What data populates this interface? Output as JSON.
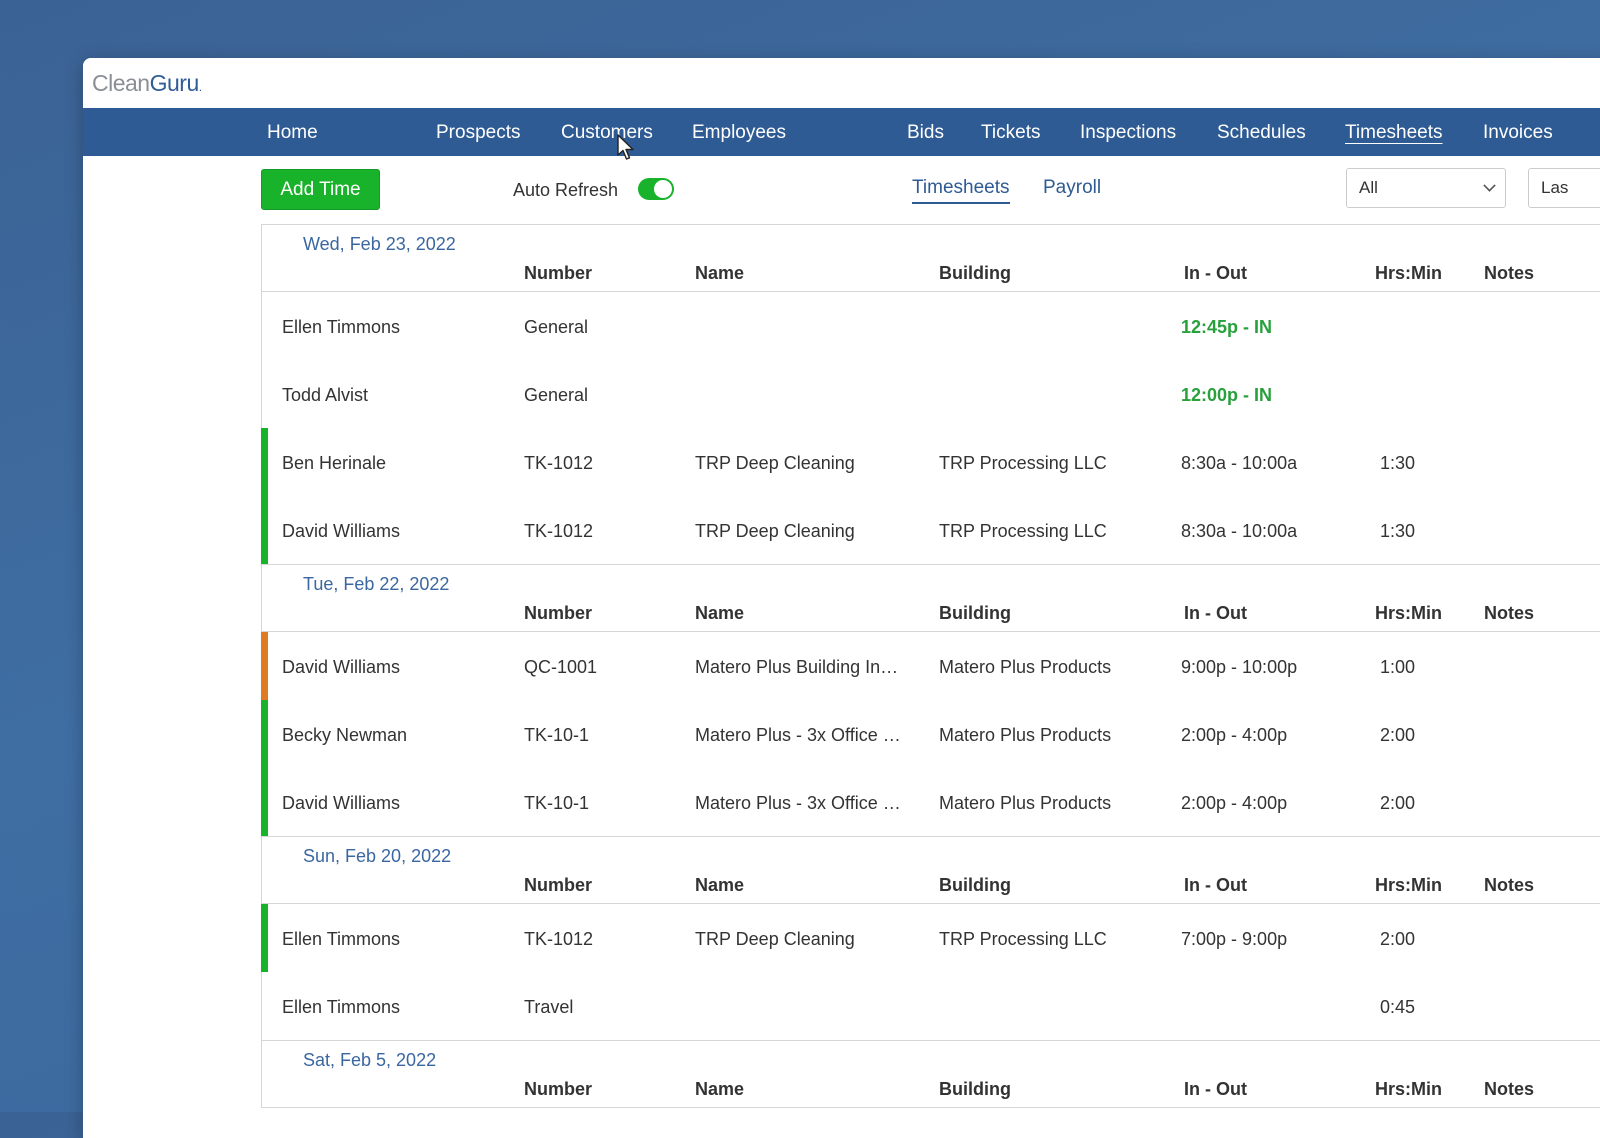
{
  "app": {
    "logo": {
      "part1": "Clean",
      "part2": "Guru",
      "dot": "."
    }
  },
  "nav": [
    {
      "label": "Home"
    },
    {
      "label": "Prospects"
    },
    {
      "label": "Customers"
    },
    {
      "label": "Employees"
    },
    {
      "label": "Bids"
    },
    {
      "label": "Tickets"
    },
    {
      "label": "Inspections"
    },
    {
      "label": "Schedules"
    },
    {
      "label": "Timesheets",
      "active": true
    },
    {
      "label": "Invoices"
    }
  ],
  "toolbar": {
    "add_time_label": "Add Time",
    "auto_refresh_label": "Auto Refresh",
    "auto_refresh_on": true,
    "tabs": [
      {
        "label": "Timesheets",
        "active": true
      },
      {
        "label": "Payroll"
      }
    ],
    "filter_value": "All",
    "period_value": "Las"
  },
  "columns": {
    "number": "Number",
    "name": "Name",
    "building": "Building",
    "in_out": "In - Out",
    "hrs_min": "Hrs:Min",
    "notes": "Notes"
  },
  "days": [
    {
      "date": "Wed, Feb 23, 2022",
      "rows": [
        {
          "employee": "Ellen Timmons",
          "number": "General",
          "name": "",
          "building": "",
          "in_out": "12:45p - IN",
          "clocked_in": true,
          "hrs": "",
          "status_color": ""
        },
        {
          "employee": "Todd Alvist",
          "number": "General",
          "name": "",
          "building": "",
          "in_out": "12:00p - IN",
          "clocked_in": true,
          "hrs": "",
          "status_color": ""
        },
        {
          "employee": "Ben Herinale",
          "number": "TK-1012",
          "name": "TRP Deep Cleaning",
          "building": "TRP Processing LLC",
          "in_out": "8:30a - 10:00a",
          "hrs": "1:30",
          "status_color": "#19b32b"
        },
        {
          "employee": "David Williams",
          "number": "TK-1012",
          "name": "TRP Deep Cleaning",
          "building": "TRP Processing LLC",
          "in_out": "8:30a - 10:00a",
          "hrs": "1:30",
          "status_color": "#19b32b"
        }
      ]
    },
    {
      "date": "Tue, Feb 22, 2022",
      "rows": [
        {
          "employee": "David Williams",
          "number": "QC-1001",
          "name": "Matero Plus Building In…",
          "building": "Matero Plus Products",
          "in_out": "9:00p - 10:00p",
          "hrs": "1:00",
          "status_color": "#e07b24"
        },
        {
          "employee": "Becky Newman",
          "number": "TK-10-1",
          "name": "Matero Plus - 3x Office …",
          "building": "Matero Plus Products",
          "in_out": "2:00p - 4:00p",
          "hrs": "2:00",
          "status_color": "#19b32b"
        },
        {
          "employee": "David Williams",
          "number": "TK-10-1",
          "name": "Matero Plus - 3x Office …",
          "building": "Matero Plus Products",
          "in_out": "2:00p - 4:00p",
          "hrs": "2:00",
          "status_color": "#19b32b"
        }
      ]
    },
    {
      "date": "Sun, Feb 20, 2022",
      "rows": [
        {
          "employee": "Ellen Timmons",
          "number": "TK-1012",
          "name": "TRP Deep Cleaning",
          "building": "TRP Processing LLC",
          "in_out": "7:00p - 9:00p",
          "hrs": "2:00",
          "status_color": "#19b32b"
        },
        {
          "employee": "Ellen Timmons",
          "number": "Travel",
          "name": "",
          "building": "",
          "in_out": "",
          "hrs": "0:45",
          "status_color": ""
        }
      ]
    },
    {
      "date": "Sat, Feb 5, 2022",
      "rows": []
    }
  ]
}
